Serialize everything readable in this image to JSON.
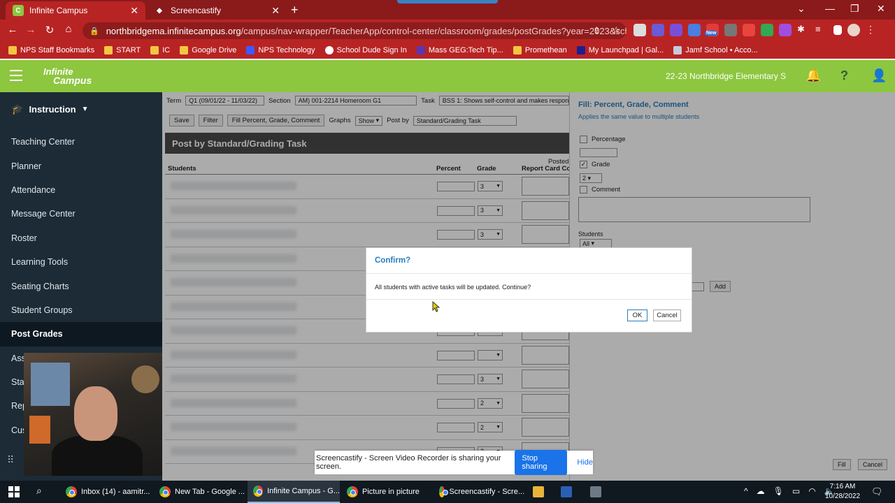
{
  "browser": {
    "tabs": [
      {
        "title": "Infinite Campus",
        "favicon": "C"
      },
      {
        "title": "Screencastify"
      }
    ],
    "url_host": "northbridgema.infinitecampus.org",
    "url_path": "/campus/nav-wrapper/TeacherApp/control-center/classroom/grades/postGrades?year=2023&scho...",
    "bookmarks": [
      "NPS Staff Bookmarks",
      "START",
      "IC",
      "Google Drive",
      "NPS Technology",
      "School Dude Sign In",
      "Mass GEG:Tech Tip...",
      "Promethean",
      "My Launchpad | Gal...",
      "Jamf School • Acco..."
    ],
    "ext_new_badge": "New"
  },
  "campus": {
    "logo_line1": "Infinite",
    "logo_line2": "Campus",
    "school": "22-23 Northbridge Elementary S"
  },
  "sidebar": {
    "section": "Instruction",
    "items": [
      "Teaching Center",
      "Planner",
      "Attendance",
      "Message Center",
      "Roster",
      "Learning Tools",
      "Seating Charts",
      "Student Groups",
      "Post Grades",
      "Ass",
      "Sta",
      "Rep",
      "Cus"
    ],
    "active_index": 8
  },
  "filters": {
    "term_label": "Term",
    "term_value": "Q1 (09/01/22 - 11/03/22)",
    "section_label": "Section",
    "section_value": "AM) 001-2214 Homeroom G1",
    "task_label": "Task",
    "task_value": "BSS 1: Shows self-control and makes respons"
  },
  "actions": {
    "save": "Save",
    "filter": "Filter",
    "fill": "Fill Percent, Grade, Comment",
    "graphs_label": "Graphs",
    "graphs_value": "Show",
    "postby_label": "Post by",
    "postby_value": "Standard/Grading Task"
  },
  "panel": {
    "title": "Post by Standard/Grading Task",
    "posted": "Posted",
    "col_students": "Students",
    "col_percent": "Percent",
    "col_grade": "Grade",
    "col_report": "Report Card Co"
  },
  "rows": [
    {
      "grade": "3"
    },
    {
      "grade": "3"
    },
    {
      "grade": "3"
    },
    {
      "grade": ""
    },
    {
      "grade": ""
    },
    {
      "grade": ""
    },
    {
      "grade": ""
    },
    {
      "grade": ""
    },
    {
      "grade": "3"
    },
    {
      "grade": "2"
    },
    {
      "grade": "2"
    },
    {
      "grade": "2"
    }
  ],
  "fill_panel": {
    "title": "Fill: Percent, Grade, Comment",
    "subtitle": "Applies the same value to multiple students",
    "percentage": "Percentage",
    "grade": "Grade",
    "grade_value": "2",
    "comment": "Comment",
    "students_label": "Students",
    "students_value": "All",
    "add": "Add",
    "fill": "Fill",
    "cancel": "Cancel"
  },
  "modal": {
    "title": "Confirm?",
    "message": "All students with active tasks will be updated. Continue?",
    "ok": "OK",
    "cancel": "Cancel"
  },
  "sharebar": {
    "message": "Screencastify - Screen Video Recorder is sharing your screen.",
    "stop": "Stop sharing",
    "hide": "Hide"
  },
  "taskbar": {
    "apps": [
      "Inbox (14) - aamitr...",
      "New Tab - Google ...",
      "Infinite Campus - G...",
      "Picture in picture",
      "Screencastify - Scre..."
    ],
    "active_index": 2,
    "time": "7:16 AM",
    "date": "10/28/2022"
  },
  "colors": {
    "chrome_red": "#b82424",
    "campus_green": "#8dc63f",
    "sidebar": "#1c2b36",
    "accent_blue": "#2a7dbc"
  }
}
